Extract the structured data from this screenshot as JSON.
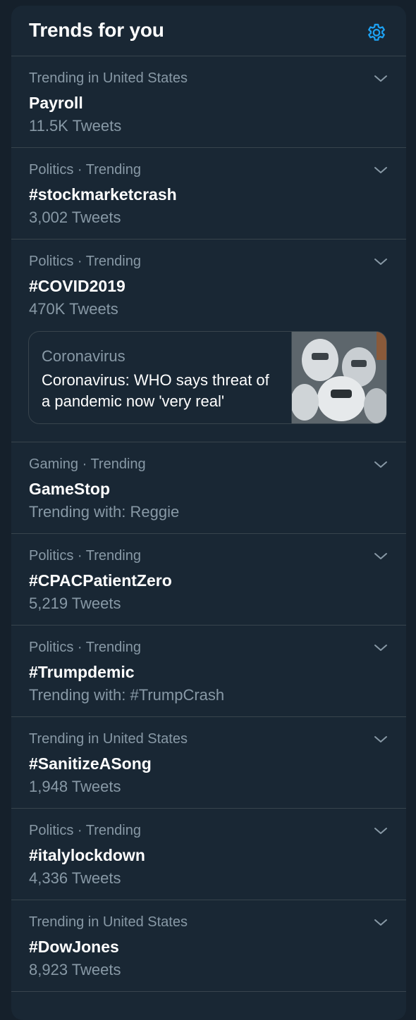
{
  "header": {
    "title": "Trends for you",
    "settings_icon": "gear-icon"
  },
  "colors": {
    "background": "#15202b",
    "panel": "#192734",
    "accent": "#1da1f2",
    "secondary_text": "#8899a6",
    "divider": "#38444d"
  },
  "trends": [
    {
      "context": "Trending in United States",
      "name": "Payroll",
      "meta": "11.5K Tweets"
    },
    {
      "context": "Politics · Trending",
      "name": "#stockmarketcrash",
      "meta": "3,002 Tweets"
    },
    {
      "context": "Politics · Trending",
      "name": "#COVID2019",
      "meta": "470K Tweets",
      "card": {
        "source": "Coronavirus",
        "headline": "Coronavirus: WHO says threat of a pandemic now 'very real'"
      }
    },
    {
      "context": "Gaming · Trending",
      "name": "GameStop",
      "meta": "Trending with: Reggie"
    },
    {
      "context": "Politics · Trending",
      "name": "#CPACPatientZero",
      "meta": "5,219 Tweets"
    },
    {
      "context": "Politics · Trending",
      "name": "#Trumpdemic",
      "meta": "Trending with: #TrumpCrash"
    },
    {
      "context": "Trending in United States",
      "name": "#SanitizeASong",
      "meta": "1,948 Tweets"
    },
    {
      "context": "Politics · Trending",
      "name": "#italylockdown",
      "meta": "4,336 Tweets"
    },
    {
      "context": "Trending in United States",
      "name": "#DowJones",
      "meta": "8,923 Tweets"
    }
  ]
}
